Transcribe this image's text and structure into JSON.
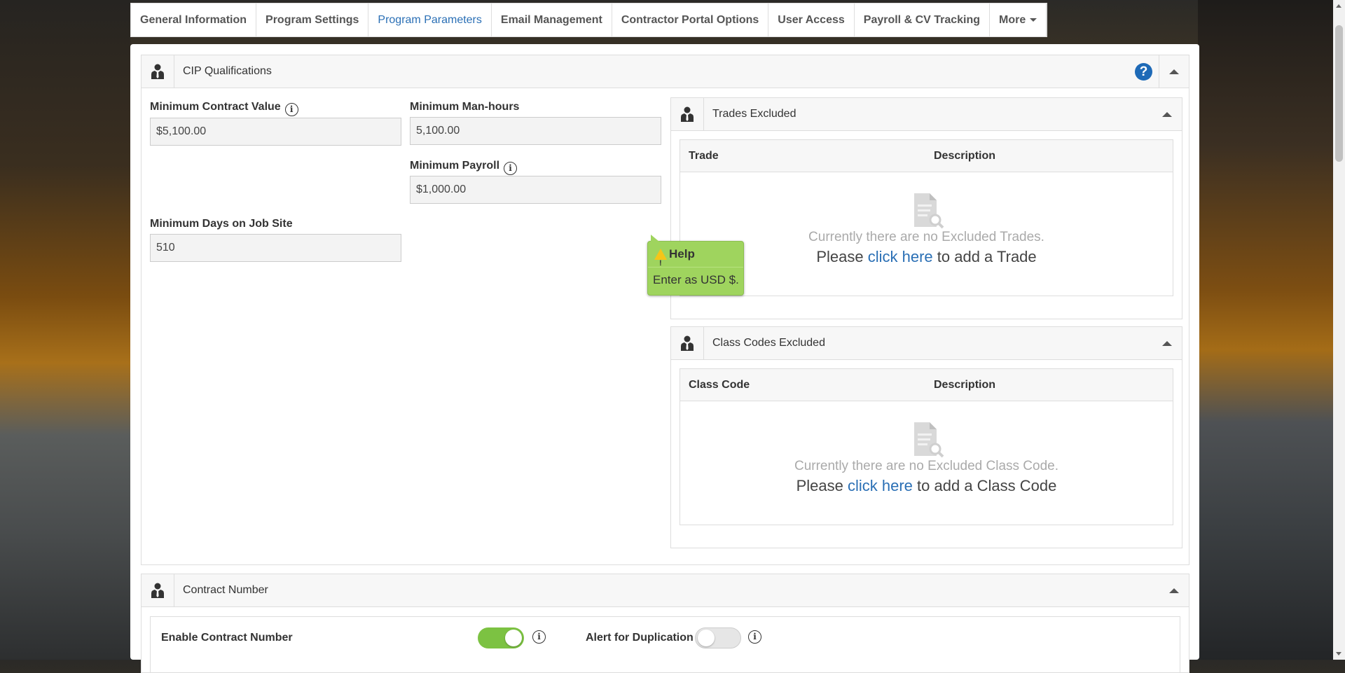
{
  "tabs": [
    {
      "label": "General Information"
    },
    {
      "label": "Program Settings"
    },
    {
      "label": "Program Parameters"
    },
    {
      "label": "Email Management"
    },
    {
      "label": "Contractor Portal Options"
    },
    {
      "label": "User Access"
    },
    {
      "label": "Payroll & CV Tracking"
    },
    {
      "label": "More"
    }
  ],
  "active_tab": "Program Parameters",
  "cip": {
    "title": "CIP Qualifications",
    "help_icon": "?",
    "min_contract_value_label": "Minimum Contract Value",
    "min_contract_value": "$5,100.00",
    "min_manhours_label": "Minimum Man-hours",
    "min_manhours": "5,100.00",
    "min_payroll_label": "Minimum Payroll",
    "min_payroll": "$1,000.00",
    "min_days_label": "Minimum Days on Job Site",
    "min_days": "510"
  },
  "tooltip": {
    "title": "Help",
    "text": "Enter as USD $."
  },
  "trades": {
    "title": "Trades Excluded",
    "col1": "Trade",
    "col2": "Description",
    "empty_msg": "Currently there are no Excluded Trades.",
    "prompt_pre": "Please ",
    "link": "click here",
    "prompt_post": " to add a Trade"
  },
  "class_codes": {
    "title": "Class Codes Excluded",
    "col1": "Class Code",
    "col2": "Description",
    "empty_msg": "Currently there are no Excluded Class Code.",
    "prompt_pre": "Please ",
    "link": "click here",
    "prompt_post": " to add a Class Code"
  },
  "contract_number": {
    "title": "Contract Number",
    "enable_label": "Enable Contract Number",
    "enable_on": true,
    "alert_label": "Alert for Duplication",
    "alert_on": false
  },
  "colors": {
    "accent": "#2a6fb5",
    "toggle_on": "#7cc242",
    "tooltip_bg": "#9fd45e",
    "help_icon_bg": "#1e6ab7"
  }
}
